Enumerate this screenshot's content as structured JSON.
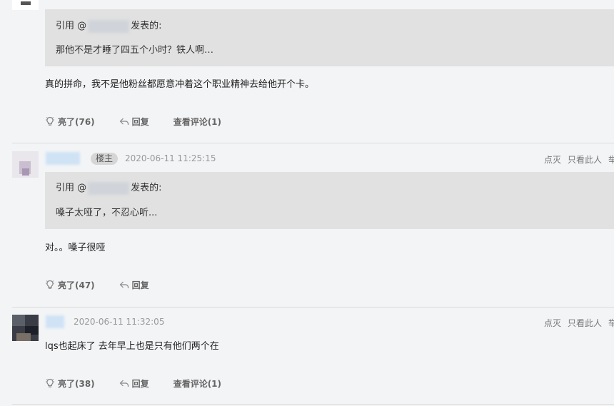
{
  "post1": {
    "quote_prefix": "引用 @",
    "quote_suffix": "发表的:",
    "quote_text": "那他不是才睡了四五个小时？铁人啊…",
    "reply": "真的拼命，我不是他粉丝都愿意冲着这个职业精神去给他开个卡。",
    "like_label": "亮了(76)",
    "reply_label": "回复",
    "comments_label": "查看评论(1)"
  },
  "post2": {
    "badge": "楼主",
    "timestamp": "2020-06-11 11:25:15",
    "right_actions": [
      "点灭",
      "只看此人",
      "举"
    ],
    "quote_prefix": "引用 @",
    "quote_suffix": "发表的:",
    "quote_text": "嗓子太哑了，不忍心听...",
    "reply": "对。。嗓子很哑",
    "like_label": "亮了(47)",
    "reply_label": "回复"
  },
  "post3": {
    "timestamp": "2020-06-11 11:32:05",
    "right_actions": [
      "点灭",
      "只看此人",
      "举"
    ],
    "reply": "lqs也起床了 去年早上也是只有他们两个在",
    "like_label": "亮了(38)",
    "reply_label": "回复",
    "comments_label": "查看评论(1)"
  },
  "colors": {
    "page_bg": "#f3f4f6",
    "quote_bg": "#e1e1e1",
    "timestamp": "#999999",
    "action_text": "#666666"
  },
  "icons": {
    "like": "lightbulb-icon",
    "reply": "reply-arrow-icon"
  }
}
